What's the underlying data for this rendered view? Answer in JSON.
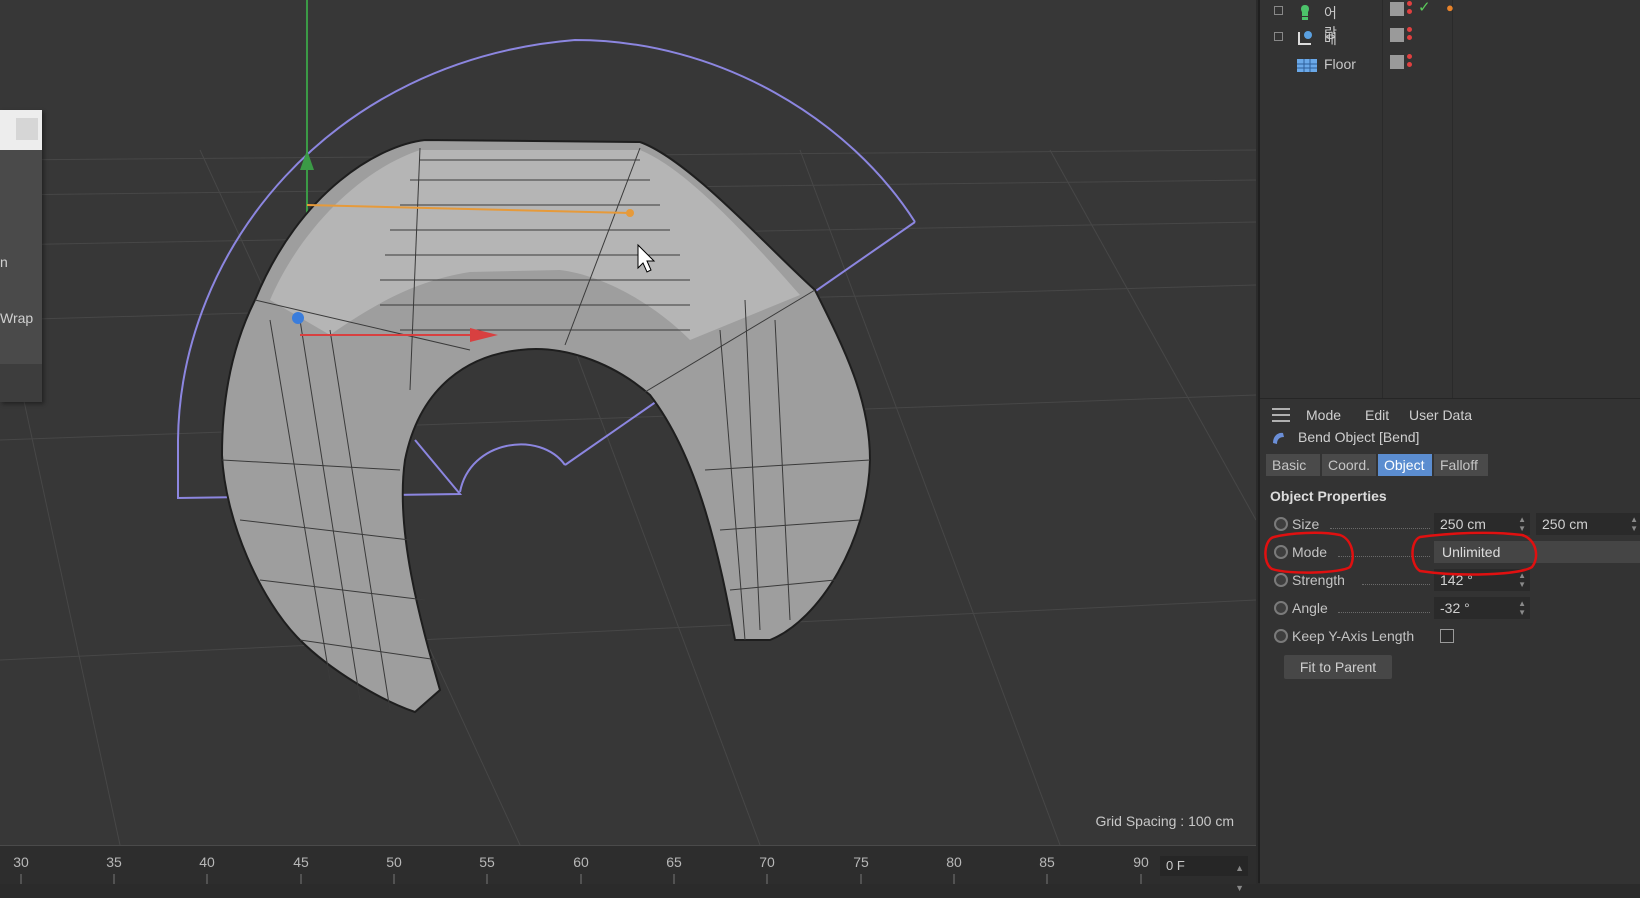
{
  "viewport": {
    "grid_spacing_label": "Grid Spacing : 100 cm",
    "left_menu": {
      "item1": "n",
      "item2": "Wrap"
    }
  },
  "timeline": {
    "ticks": [
      "30",
      "35",
      "40",
      "45",
      "50",
      "55",
      "60",
      "65",
      "70",
      "75",
      "80",
      "85",
      "90"
    ],
    "current_frame": "0 F"
  },
  "object_manager": {
    "objects": [
      {
        "name": "어랑",
        "icon": "bulb-icon"
      },
      {
        "name": "배",
        "icon": "null-icon"
      },
      {
        "name": "Floor",
        "icon": "floor-icon"
      }
    ]
  },
  "attribute_manager": {
    "menu": [
      "Mode",
      "Edit",
      "User Data"
    ],
    "object_title": "Bend Object [Bend]",
    "tabs": [
      "Basic",
      "Coord.",
      "Object",
      "Falloff"
    ],
    "active_tab": "Object",
    "section_title": "Object Properties",
    "properties": {
      "size": {
        "label": "Size",
        "value_y": "250 cm",
        "value_z": "250 cm"
      },
      "mode": {
        "label": "Mode",
        "value": "Unlimited"
      },
      "strength": {
        "label": "Strength",
        "value": "142 °"
      },
      "angle": {
        "label": "Angle",
        "value": "-32 °"
      },
      "keep_y": {
        "label": "Keep Y-Axis Length",
        "checked": false
      }
    },
    "fit_button": "Fit to Parent"
  },
  "colors": {
    "active_tab": "#5b8dd0",
    "annotation": "#e01010",
    "deformer_outline": "#8c86e0"
  }
}
